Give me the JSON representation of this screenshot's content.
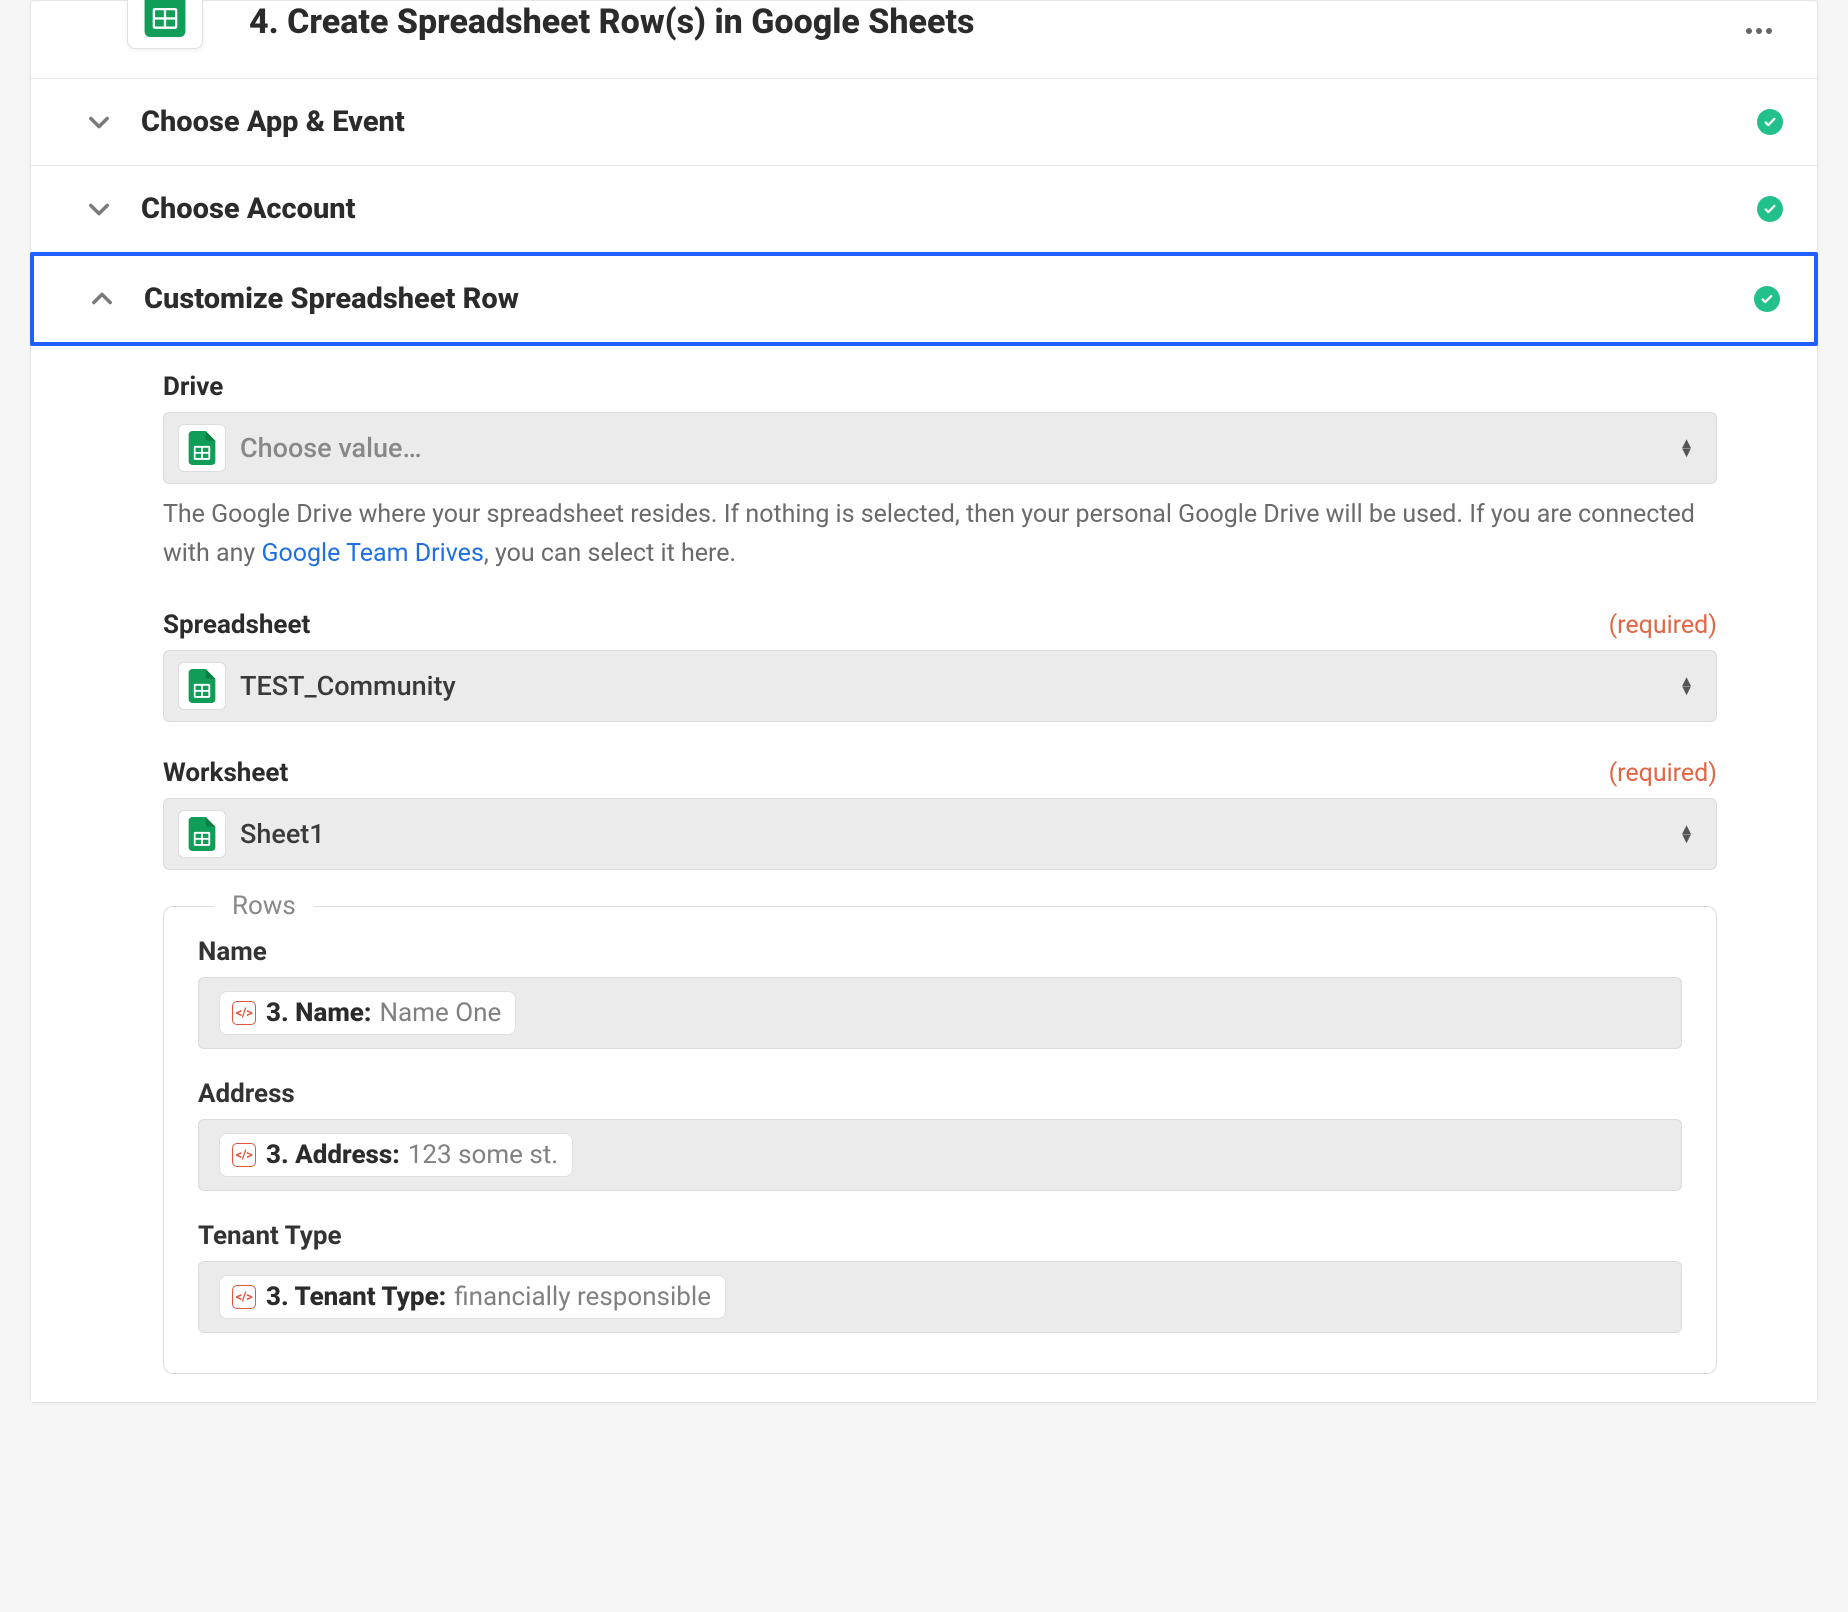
{
  "step": {
    "title": "4. Create Spreadsheet Row(s) in Google Sheets"
  },
  "sections": {
    "appEvent": {
      "title": "Choose App & Event"
    },
    "account": {
      "title": "Choose Account"
    },
    "customize": {
      "title": "Customize Spreadsheet Row"
    }
  },
  "fields": {
    "drive": {
      "label": "Drive",
      "placeholder": "Choose value…",
      "help_before": "The Google Drive where your spreadsheet resides. If nothing is selected, then your personal Google Drive will be used. If you are connected with any ",
      "help_link": "Google Team Drives",
      "help_after": ", you can select it here."
    },
    "spreadsheet": {
      "label": "Spreadsheet",
      "required": "(required)",
      "value": "TEST_Community"
    },
    "worksheet": {
      "label": "Worksheet",
      "required": "(required)",
      "value": "Sheet1"
    }
  },
  "rows": {
    "legend": "Rows",
    "items": [
      {
        "label": "Name",
        "ref": "3. Name:",
        "value": "Name One"
      },
      {
        "label": "Address",
        "ref": "3. Address:",
        "value": "123 some st."
      },
      {
        "label": "Tenant Type",
        "ref": "3. Tenant Type:",
        "value": "financially responsible"
      }
    ]
  }
}
